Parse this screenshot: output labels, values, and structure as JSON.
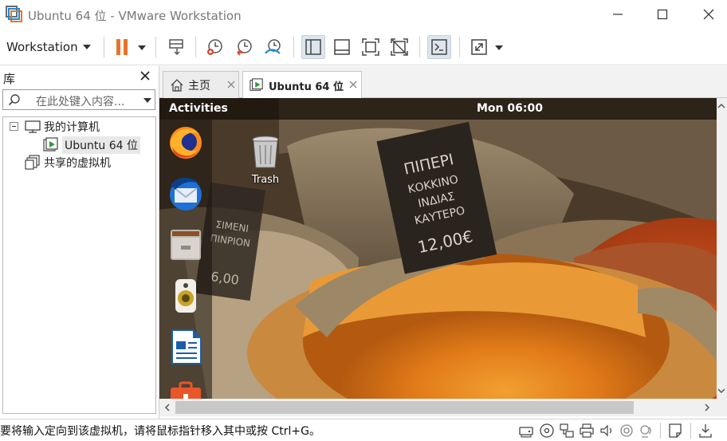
{
  "window": {
    "title": "Ubuntu 64 位 - VMware Workstation",
    "minimize_icon": "minimize-icon",
    "maximize_icon": "maximize-icon",
    "close_icon": "close-icon"
  },
  "toolbar": {
    "menu_label": "Workstation",
    "buttons": [
      "pause-icon",
      "send-ctrl-alt-del-icon",
      "snapshot-icon",
      "revert-snapshot-icon",
      "snapshot-manager-icon",
      "show-library-icon",
      "single-window-icon",
      "full-screen-icon",
      "unity-icon",
      "console-view-icon",
      "stretch-guest-icon"
    ],
    "accent_color": "#e8742a"
  },
  "library": {
    "title": "库",
    "search_placeholder": "在此处键入内容...",
    "tree": {
      "my_computer": "我的计算机",
      "vm_name": "Ubuntu 64 位",
      "shared_vms": "共享的虚拟机"
    }
  },
  "tabs": [
    {
      "label": "主页",
      "icon": "home-icon"
    },
    {
      "label": "Ubuntu 64 位",
      "icon": "vm-running-icon"
    }
  ],
  "guest": {
    "activities": "Activities",
    "clock": "Mon 06:00",
    "dock": [
      "firefox-icon",
      "thunderbird-icon",
      "files-icon",
      "rhythmbox-icon",
      "libreoffice-writer-icon",
      "ubuntu-software-icon"
    ],
    "desktop": {
      "trash_label": "Trash"
    },
    "sign_text": "ΠΙΠΕΡΙ ΚΟΚΚΙΝΟ ΙΝΔΙΑΣ ΚΑΥΤΕΡΟ 12,00€"
  },
  "status": {
    "message": "要将输入定向到该虚拟机，请将鼠标指针移入其中或按 Ctrl+G。",
    "device_icons": [
      "hard-disk-icon",
      "cd-dvd-icon",
      "network-icon",
      "printer-icon",
      "sound-icon",
      "usb-icon",
      "display-icon",
      "message-icon",
      "download-icon"
    ]
  }
}
